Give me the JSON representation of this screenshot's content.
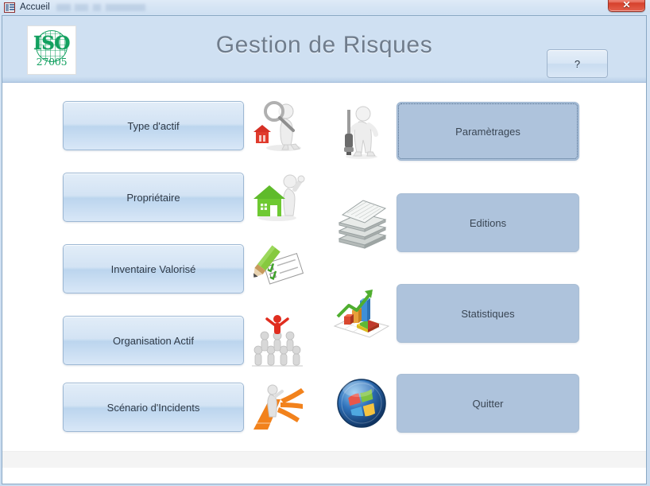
{
  "window": {
    "title": "Accueil",
    "doc_icon": "access-form-icon",
    "close_label": "✕",
    "close_icon": "close-icon"
  },
  "header": {
    "app_title": "Gestion de Risques",
    "logo": {
      "icon": "iso-globe-icon",
      "word": "ISO",
      "number": "27005"
    },
    "help_label": "?"
  },
  "menu": {
    "left_column": [
      {
        "label": "Type d'actif",
        "icon": "magnifier-house-icon"
      },
      {
        "label": "Propriétaire",
        "icon": "green-house-person-icon"
      },
      {
        "label": "Inventaire Valorisé",
        "icon": "pencil-checklist-icon"
      },
      {
        "label": "Organisation Actif",
        "icon": "people-pyramid-icon"
      },
      {
        "label": "Scénario d'Incidents",
        "icon": "branching-path-icon"
      }
    ],
    "right_column": [
      {
        "label": "Paramètrages",
        "icon": "person-screwdriver-icon",
        "focused": true
      },
      {
        "label": "Editions",
        "icon": "paper-stack-icon",
        "focused": false
      },
      {
        "label": "Statistiques",
        "icon": "3d-charts-icon",
        "focused": false
      },
      {
        "label": "Quitter",
        "icon": "windows-orb-icon",
        "focused": false
      }
    ]
  },
  "colors": {
    "header_bg": "#cfe0f2",
    "title_text": "#6f7c8c",
    "left_button": "#d3e3f4",
    "right_button": "#aec3dc",
    "iso_green": "#12a05f",
    "close_red": "#d6412c"
  }
}
